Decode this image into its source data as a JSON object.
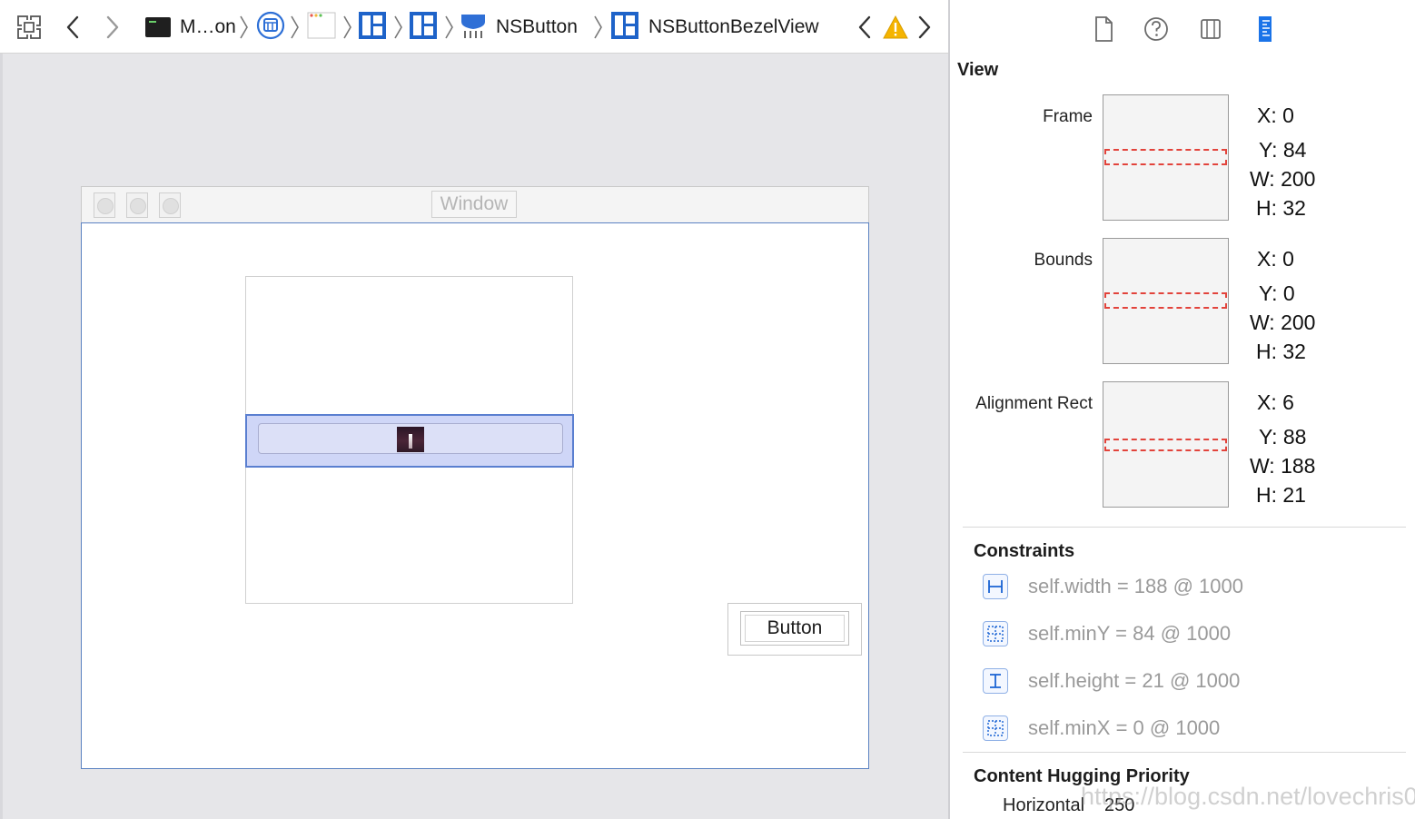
{
  "jumpbar": {
    "crumb_project": "M…on",
    "crumb_button": "NSButton",
    "crumb_bezel": "NSButtonBezelView"
  },
  "canvas": {
    "window_title": "Window",
    "plain_button_label": "Button"
  },
  "inspector": {
    "section_title": "View",
    "frame": {
      "label": "Frame",
      "x": "0",
      "y": "84",
      "w": "200",
      "h": "32"
    },
    "bounds": {
      "label": "Bounds",
      "x": "0",
      "y": "0",
      "w": "200",
      "h": "32"
    },
    "alignment": {
      "label": "Alignment Rect",
      "x": "6",
      "y": "88",
      "w": "188",
      "h": "21"
    },
    "coord_keys": {
      "x": "X:",
      "y": "Y:",
      "w": "W:",
      "h": "H:"
    },
    "constraints_title": "Constraints",
    "constraints": [
      "self.width = 188 @ 1000",
      "self.minY = 84 @ 1000",
      "self.height = 21 @ 1000",
      "self.minX = 0 @ 1000"
    ],
    "hugging_title": "Content Hugging Priority",
    "hugging_horizontal_label": "Horizontal",
    "hugging_horizontal_value": "250"
  },
  "watermark": "https://blog.csdn.net/lovechris00",
  "colors": {
    "accent": "#1a73e8",
    "selection_fill": "#cfd6f7",
    "selection_border": "#5a7fd0",
    "dashed_rect": "#e2433b",
    "warning": "#f5b400"
  }
}
